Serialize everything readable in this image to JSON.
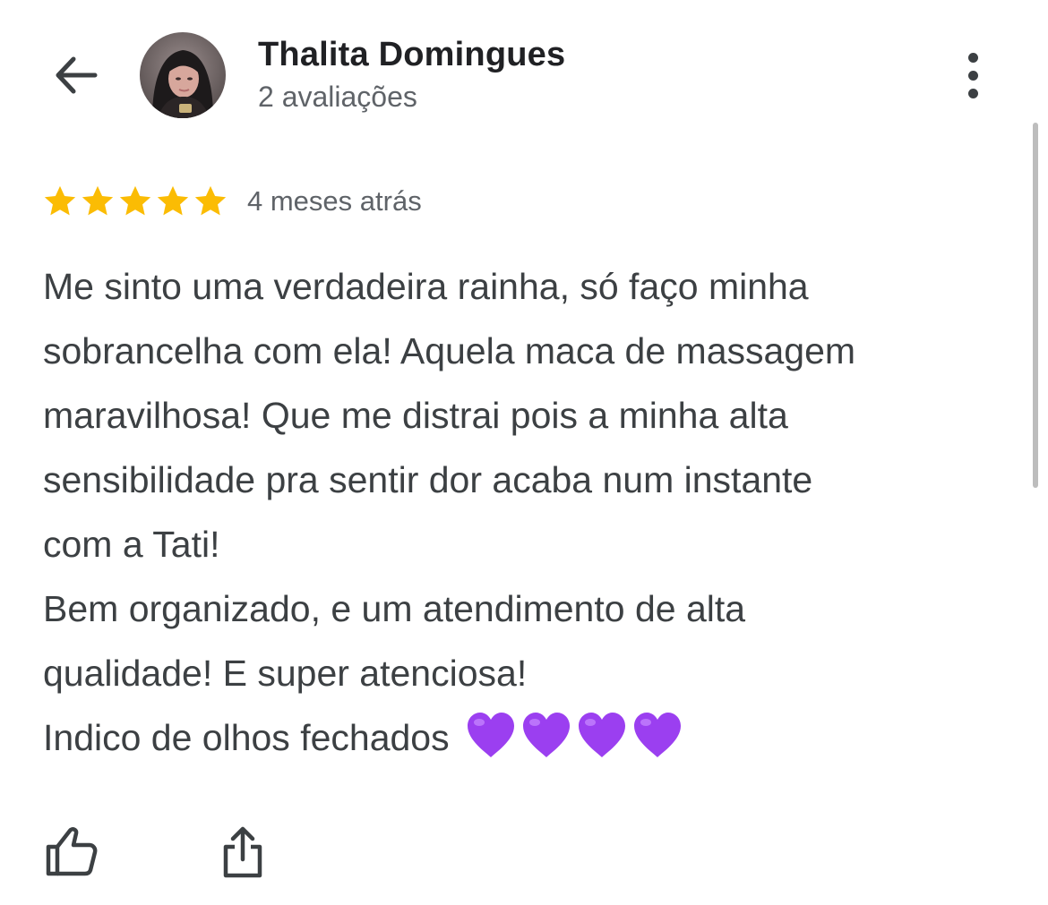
{
  "header": {
    "author_name": "Thalita Domingues",
    "review_count": "2 avaliações",
    "back_icon": "arrow-left-icon",
    "more_icon": "more-vertical-icon"
  },
  "review": {
    "rating": 5,
    "rating_max": 5,
    "time": "4 meses atrás",
    "lines": [
      "Me sinto uma verdadeira rainha, só faço minha",
      "sobrancelha com ela! Aquela maca de massagem",
      "maravilhosa! Que me distrai pois a minha alta",
      "sensibilidade pra sentir dor acaba num instante",
      "com a Tati!",
      "Bem organizado, e um atendimento de alta",
      "qualidade! E super atenciosa!",
      "Indico de olhos fechados"
    ],
    "emoji": "💜💜💜💜"
  },
  "actions": {
    "like_icon": "thumbs-up-icon",
    "share_icon": "share-icon"
  },
  "colors": {
    "star": "#fbbc04",
    "heart": "#9b3ff0",
    "text": "#3c4043",
    "secondary_text": "#5f6368",
    "title": "#202124"
  }
}
